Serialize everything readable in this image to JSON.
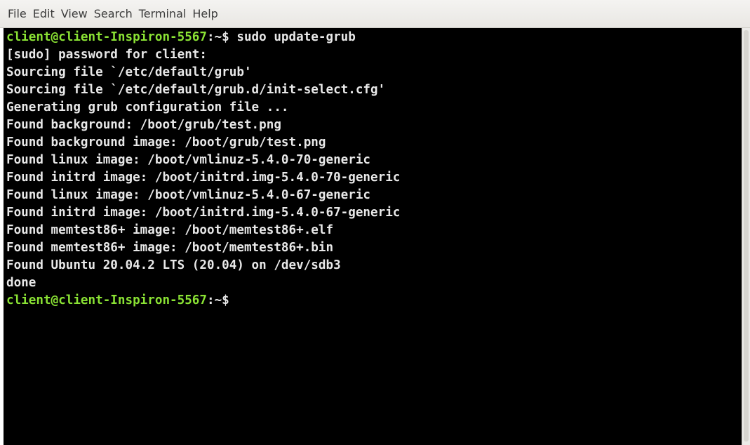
{
  "menu": {
    "items": [
      "File",
      "Edit",
      "View",
      "Search",
      "Terminal",
      "Help"
    ]
  },
  "terminal": {
    "prompt_user": "client@client-Inspiron-5567",
    "prompt_path": ":~$",
    "command": " sudo update-grub",
    "output": [
      "[sudo] password for client:",
      "Sourcing file `/etc/default/grub'",
      "Sourcing file `/etc/default/grub.d/init-select.cfg'",
      "Generating grub configuration file ...",
      "Found background: /boot/grub/test.png",
      "Found background image: /boot/grub/test.png",
      "Found linux image: /boot/vmlinuz-5.4.0-70-generic",
      "Found initrd image: /boot/initrd.img-5.4.0-70-generic",
      "Found linux image: /boot/vmlinuz-5.4.0-67-generic",
      "Found initrd image: /boot/initrd.img-5.4.0-67-generic",
      "Found memtest86+ image: /boot/memtest86+.elf",
      "Found memtest86+ image: /boot/memtest86+.bin",
      "Found Ubuntu 20.04.2 LTS (20.04) on /dev/sdb3",
      "done"
    ]
  },
  "colors": {
    "prompt_user": "#8ae234",
    "text": "#e8e8e8",
    "background": "#000000"
  }
}
